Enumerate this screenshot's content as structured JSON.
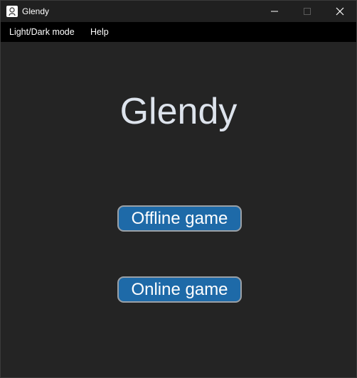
{
  "window": {
    "title": "Glendy",
    "icons": {
      "app": "app-icon",
      "minimize": "minimize-icon",
      "maximize": "maximize-icon",
      "close": "close-icon"
    }
  },
  "menubar": {
    "items": [
      {
        "label": "Light/Dark mode"
      },
      {
        "label": "Help"
      }
    ]
  },
  "main": {
    "title": "Glendy",
    "buttons": {
      "offline": "Offline game",
      "online": "Online game"
    }
  },
  "colors": {
    "background": "#242424",
    "titlebar": "#202020",
    "menubar": "#000000",
    "button_fill": "#1e6aa8",
    "button_border": "#9aa0a6",
    "title_text": "#dde3ec"
  }
}
